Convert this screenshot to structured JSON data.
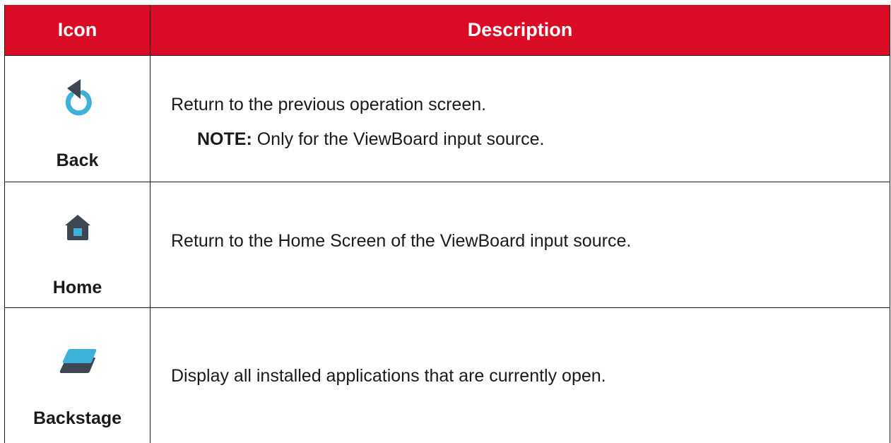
{
  "table": {
    "header": {
      "icon_col": "Icon",
      "desc_col": "Description"
    },
    "rows": [
      {
        "label": "Back",
        "icon": "back-icon",
        "description": "Return to the previous operation screen.",
        "note_label": "NOTE:",
        "note_text": " Only for the ViewBoard input source."
      },
      {
        "label": "Home",
        "icon": "home-icon",
        "description": "Return to the Home Screen of the ViewBoard input source."
      },
      {
        "label": "Backstage",
        "icon": "backstage-icon",
        "description": "Display all installed applications that are currently open."
      }
    ]
  },
  "colors": {
    "header_bg": "#d90b25",
    "icon_blue": "#3eb1da",
    "icon_dark": "#3e4652",
    "text": "#1a1a1a"
  }
}
